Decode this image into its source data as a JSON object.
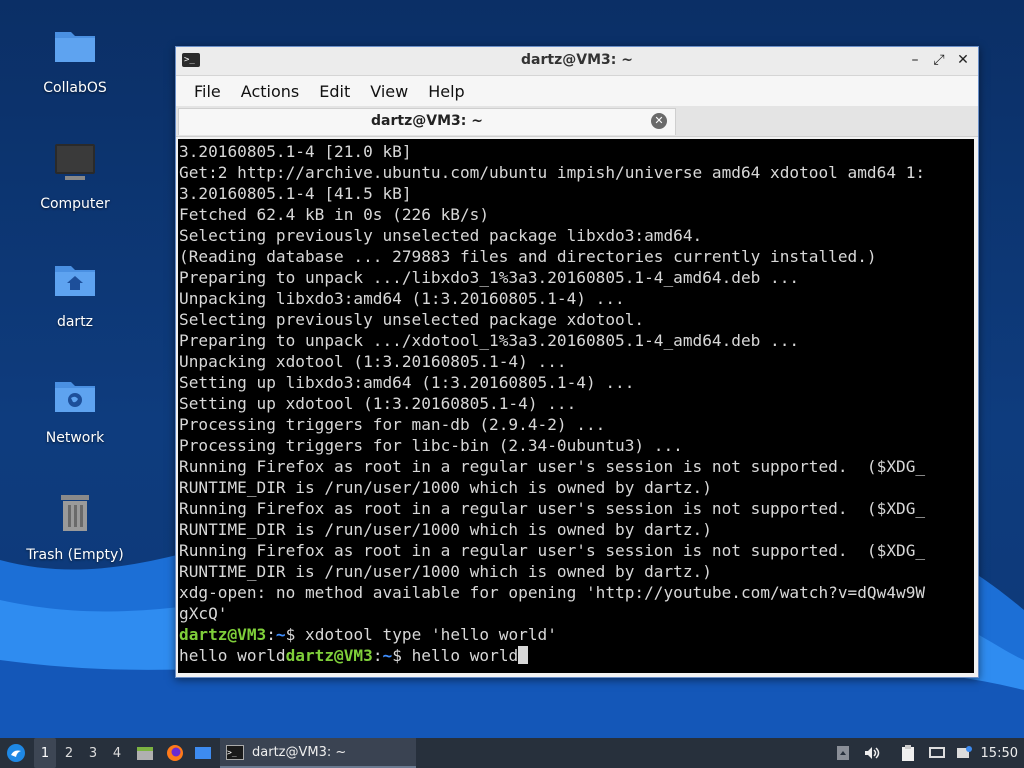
{
  "desktop": {
    "icons": [
      {
        "label": "CollabOS"
      },
      {
        "label": "Computer"
      },
      {
        "label": "dartz"
      },
      {
        "label": "Network"
      },
      {
        "label": "Trash (Empty)"
      }
    ]
  },
  "window": {
    "title": "dartz@VM3: ~",
    "menu": [
      "File",
      "Actions",
      "Edit",
      "View",
      "Help"
    ],
    "tab_label": "dartz@VM3: ~",
    "terminal": {
      "lines": [
        "3.20160805.1-4 [21.0 kB]",
        "Get:2 http://archive.ubuntu.com/ubuntu impish/universe amd64 xdotool amd64 1:",
        "3.20160805.1-4 [41.5 kB]",
        "Fetched 62.4 kB in 0s (226 kB/s)",
        "Selecting previously unselected package libxdo3:amd64.",
        "(Reading database ... 279883 files and directories currently installed.)",
        "Preparing to unpack .../libxdo3_1%3a3.20160805.1-4_amd64.deb ...",
        "Unpacking libxdo3:amd64 (1:3.20160805.1-4) ...",
        "Selecting previously unselected package xdotool.",
        "Preparing to unpack .../xdotool_1%3a3.20160805.1-4_amd64.deb ...",
        "Unpacking xdotool (1:3.20160805.1-4) ...",
        "Setting up libxdo3:amd64 (1:3.20160805.1-4) ...",
        "Setting up xdotool (1:3.20160805.1-4) ...",
        "Processing triggers for man-db (2.9.4-2) ...",
        "Processing triggers for libc-bin (2.34-0ubuntu3) ...",
        "Running Firefox as root in a regular user's session is not supported.  ($XDG_",
        "RUNTIME_DIR is /run/user/1000 which is owned by dartz.)",
        "Running Firefox as root in a regular user's session is not supported.  ($XDG_",
        "RUNTIME_DIR is /run/user/1000 which is owned by dartz.)",
        "Running Firefox as root in a regular user's session is not supported.  ($XDG_",
        "RUNTIME_DIR is /run/user/1000 which is owned by dartz.)",
        "xdg-open: no method available for opening 'http://youtube.com/watch?v=dQw4w9W",
        "gXcQ'"
      ],
      "prompt1": {
        "user": "dartz@VM3",
        "sep": ":",
        "path": "~",
        "sym": "$",
        "cmd": " xdotool type 'hello world'"
      },
      "prompt2": {
        "pre": "hello world",
        "user": "dartz@VM3",
        "sep": ":",
        "path": "~",
        "sym": "$",
        "cmd": " hello world"
      }
    }
  },
  "taskbar": {
    "workspaces": [
      "1",
      "2",
      "3",
      "4"
    ],
    "active_workspace": "1",
    "task_label": "dartz@VM3: ~",
    "clock": "15:50"
  },
  "colors": {
    "prompt_user": "#7fcf3a",
    "prompt_path": "#3f8fff",
    "taskbar_bg": "#27303c"
  }
}
